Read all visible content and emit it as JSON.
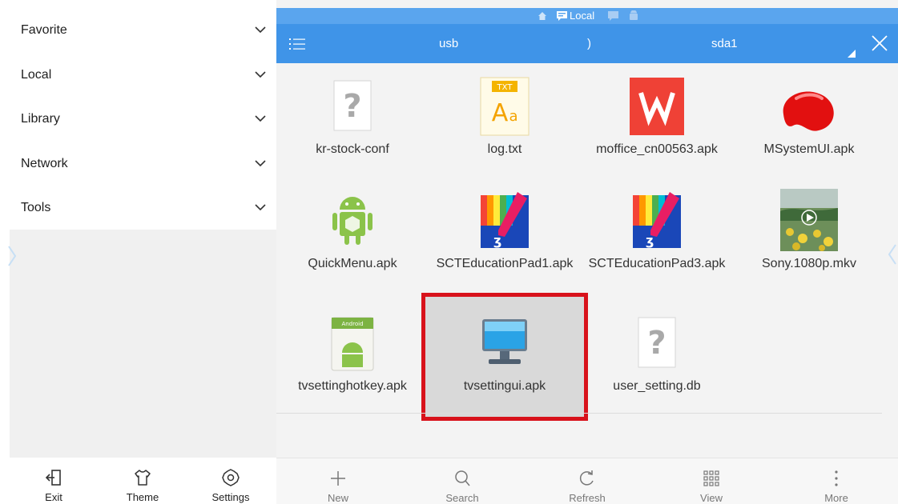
{
  "sidebar": {
    "items": [
      {
        "label": "Favorite"
      },
      {
        "label": "Local"
      },
      {
        "label": "Library"
      },
      {
        "label": "Network"
      },
      {
        "label": "Tools"
      }
    ],
    "bottom": {
      "exit": "Exit",
      "theme": "Theme",
      "settings": "Settings"
    }
  },
  "header": {
    "status_title": "Local",
    "breadcrumb": [
      "usb",
      ")",
      "sda1"
    ]
  },
  "files": [
    {
      "name": "kr-stock-conf",
      "icon": "unknown-file-icon"
    },
    {
      "name": "log.txt",
      "icon": "text-file-icon"
    },
    {
      "name": "moffice_cn00563.apk",
      "icon": "wps-office-icon"
    },
    {
      "name": "MSystemUI.apk",
      "icon": "red-bean-icon"
    },
    {
      "name": "QuickMenu.apk",
      "icon": "android-icon"
    },
    {
      "name": "SCTEducationPad1.apk",
      "icon": "education-pad-icon"
    },
    {
      "name": "SCTEducationPad3.apk",
      "icon": "education-pad-icon"
    },
    {
      "name": "Sony.1080p.mkv",
      "icon": "video-thumbnail-icon"
    },
    {
      "name": "tvsettinghotkey.apk",
      "icon": "android-app-icon"
    },
    {
      "name": "tvsettingui.apk",
      "icon": "monitor-icon",
      "selected": true
    },
    {
      "name": "user_setting.db",
      "icon": "unknown-file-icon"
    }
  ],
  "toolbar": {
    "new": "New",
    "search": "Search",
    "refresh": "Refresh",
    "view": "View",
    "more": "More"
  },
  "colors": {
    "header_blue": "#3f94e8",
    "selection_border": "#d8121b"
  }
}
